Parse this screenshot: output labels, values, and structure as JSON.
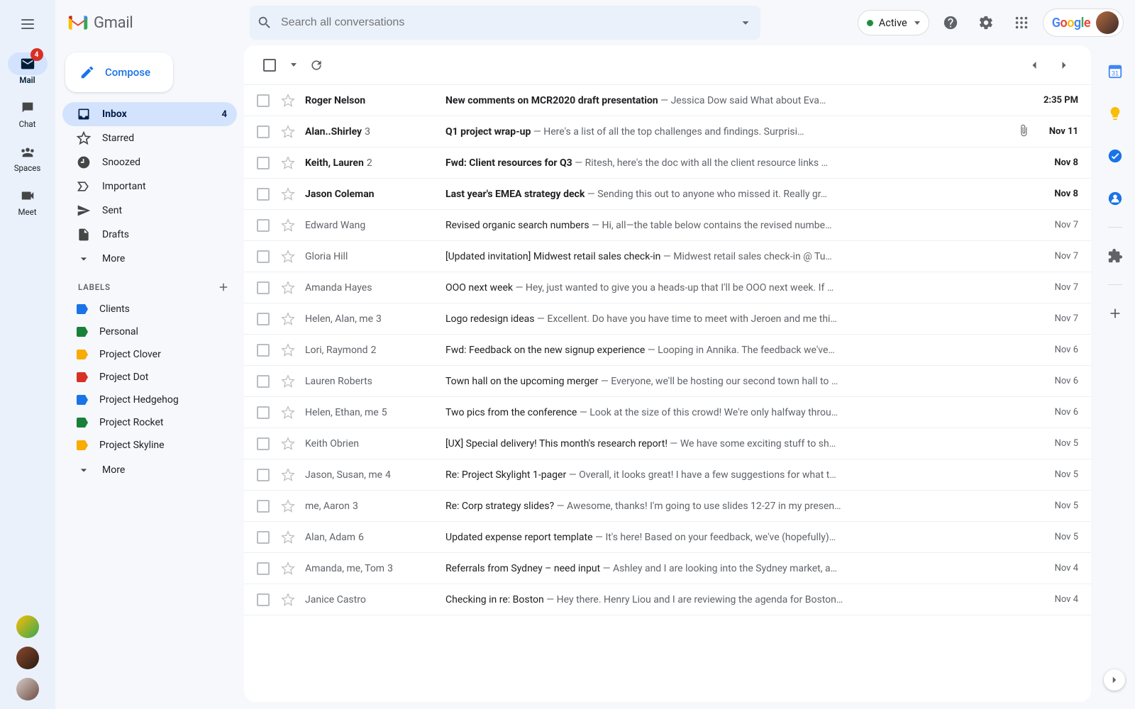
{
  "rail": {
    "mail": "Mail",
    "mail_badge": "4",
    "chat": "Chat",
    "spaces": "Spaces",
    "meet": "Meet"
  },
  "header": {
    "product": "Gmail",
    "search_placeholder": "Search all conversations",
    "status_label": "Active",
    "google": "Google"
  },
  "compose": {
    "label": "Compose"
  },
  "nav": {
    "inbox": {
      "label": "Inbox",
      "count": "4"
    },
    "starred": "Starred",
    "snoozed": "Snoozed",
    "important": "Important",
    "sent": "Sent",
    "drafts": "Drafts",
    "more": "More"
  },
  "labels_header": "LABELS",
  "labels": [
    {
      "name": "Clients",
      "color": "#1a73e8"
    },
    {
      "name": "Personal",
      "color": "#188038"
    },
    {
      "name": "Project Clover",
      "color": "#f9ab00"
    },
    {
      "name": "Project Dot",
      "color": "#d93025"
    },
    {
      "name": "Project Hedgehog",
      "color": "#1a73e8"
    },
    {
      "name": "Project Rocket",
      "color": "#188038"
    },
    {
      "name": "Project Skyline",
      "color": "#f9ab00"
    }
  ],
  "labels_more": "More",
  "emails": [
    {
      "from": "Roger Nelson",
      "thread": "",
      "subject": "New comments on MCR2020 draft presentation",
      "snippet": "Jessica Dow said What about Eva…",
      "date": "2:35 PM",
      "unread": true,
      "attach": false
    },
    {
      "from": "Alan..Shirley",
      "thread": "3",
      "subject": "Q1 project wrap-up",
      "snippet": "Here's a list of all the top challenges and findings. Surprisi…",
      "date": "Nov 11",
      "unread": true,
      "attach": true
    },
    {
      "from": "Keith, Lauren",
      "thread": "2",
      "subject": "Fwd: Client resources for Q3",
      "snippet": "Ritesh, here's the doc with all the client resource links …",
      "date": "Nov 8",
      "unread": true,
      "attach": false
    },
    {
      "from": "Jason Coleman",
      "thread": "",
      "subject": "Last year's EMEA strategy deck",
      "snippet": "Sending this out to anyone who missed it. Really gr…",
      "date": "Nov 8",
      "unread": true,
      "attach": false
    },
    {
      "from": "Edward Wang",
      "thread": "",
      "subject": "Revised organic search numbers",
      "snippet": "Hi, all—the table below contains the revised numbe…",
      "date": "Nov 7",
      "unread": false,
      "attach": false
    },
    {
      "from": "Gloria Hill",
      "thread": "",
      "subject": "[Updated invitation] Midwest retail sales check-in",
      "snippet": "Midwest retail sales check-in @ Tu…",
      "date": "Nov 7",
      "unread": false,
      "attach": false
    },
    {
      "from": "Amanda Hayes",
      "thread": "",
      "subject": "OOO next week",
      "snippet": "Hey, just wanted to give you a heads-up that I'll be OOO next week. If …",
      "date": "Nov 7",
      "unread": false,
      "attach": false
    },
    {
      "from": "Helen, Alan, me",
      "thread": "3",
      "subject": "Logo redesign ideas",
      "snippet": "Excellent. Do have you have time to meet with Jeroen and me thi…",
      "date": "Nov 7",
      "unread": false,
      "attach": false
    },
    {
      "from": "Lori, Raymond",
      "thread": "2",
      "subject": "Fwd: Feedback on the new signup experience",
      "snippet": "Looping in Annika. The feedback we've…",
      "date": "Nov 6",
      "unread": false,
      "attach": false
    },
    {
      "from": "Lauren Roberts",
      "thread": "",
      "subject": "Town hall on the upcoming merger",
      "snippet": "Everyone, we'll be hosting our second town hall to …",
      "date": "Nov 6",
      "unread": false,
      "attach": false
    },
    {
      "from": "Helen, Ethan, me",
      "thread": "5",
      "subject": "Two pics from the conference",
      "snippet": "Look at the size of this crowd! We're only halfway throu…",
      "date": "Nov 6",
      "unread": false,
      "attach": false
    },
    {
      "from": "Keith Obrien",
      "thread": "",
      "subject": "[UX] Special delivery! This month's research report!",
      "snippet": "We have some exciting stuff to sh…",
      "date": "Nov 5",
      "unread": false,
      "attach": false
    },
    {
      "from": "Jason, Susan, me",
      "thread": "4",
      "subject": "Re: Project Skylight 1-pager",
      "snippet": "Overall, it looks great! I have a few suggestions for what t…",
      "date": "Nov 5",
      "unread": false,
      "attach": false
    },
    {
      "from": "me, Aaron",
      "thread": "3",
      "subject": "Re: Corp strategy slides?",
      "snippet": "Awesome, thanks! I'm going to use slides 12-27 in my presen…",
      "date": "Nov 5",
      "unread": false,
      "attach": false
    },
    {
      "from": "Alan, Adam",
      "thread": "6",
      "subject": "Updated expense report template",
      "snippet": "It's here! Based on your feedback, we've (hopefully)…",
      "date": "Nov 5",
      "unread": false,
      "attach": false
    },
    {
      "from": "Amanda, me, Tom",
      "thread": "3",
      "subject": "Referrals from Sydney – need input",
      "snippet": "Ashley and I are looking into the Sydney market, a…",
      "date": "Nov 4",
      "unread": false,
      "attach": false
    },
    {
      "from": "Janice Castro",
      "thread": "",
      "subject": "Checking in re: Boston",
      "snippet": "Hey there. Henry Liou and I are reviewing the agenda for Boston…",
      "date": "Nov 4",
      "unread": false,
      "attach": false
    }
  ]
}
